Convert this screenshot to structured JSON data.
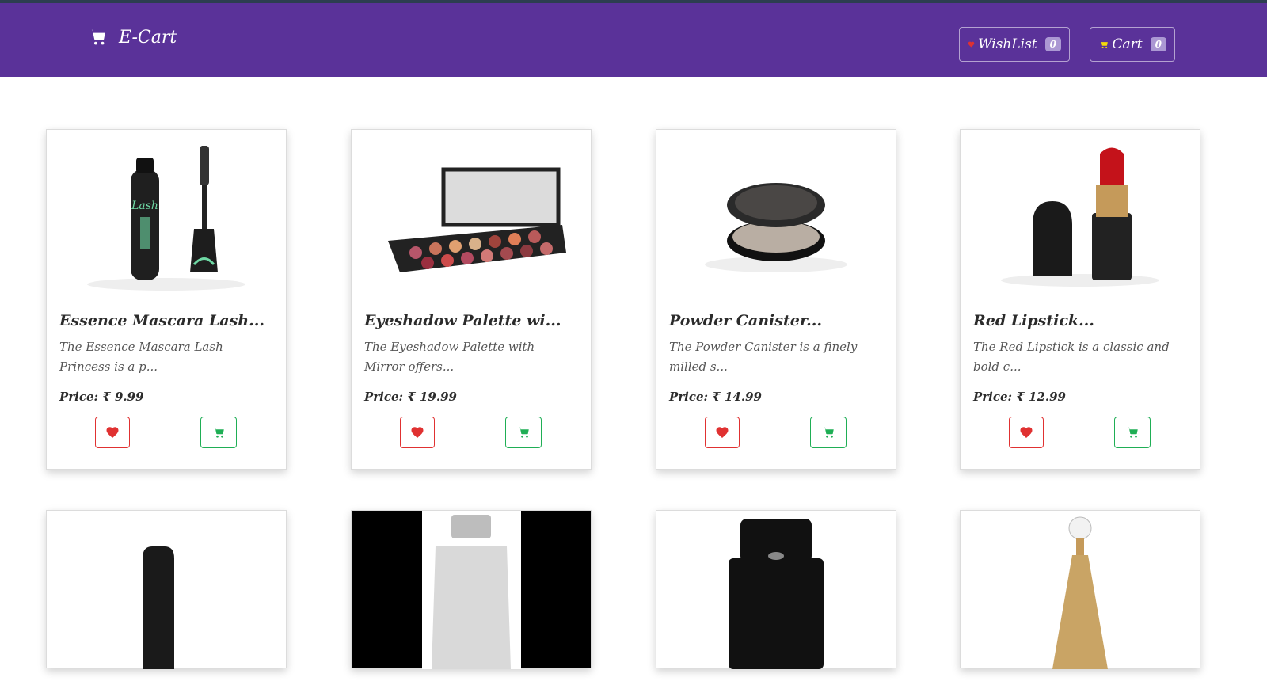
{
  "app": {
    "brand": "E-Cart",
    "wishlist_label": "WishList",
    "wishlist_count": "0",
    "cart_label": "Cart",
    "cart_count": "0"
  },
  "colors": {
    "navbar": "#5a3299",
    "wish": "#e03131",
    "cart": "#1fae55",
    "cart_nav_icon": "#f5d90a"
  },
  "products": [
    {
      "title": "Essence Mascara Lash...",
      "desc": "The Essence Mascara Lash Princess is a p...",
      "price": "Price: ₹ 9.99",
      "icon": "mascara-image"
    },
    {
      "title": "Eyeshadow Palette wi...",
      "desc": "The Eyeshadow Palette with Mirror offers...",
      "price": "Price: ₹ 19.99",
      "icon": "eyeshadow-palette-image"
    },
    {
      "title": "Powder Canister...",
      "desc": "The Powder Canister is a finely milled s...",
      "price": "Price: ₹ 14.99",
      "icon": "powder-canister-image"
    },
    {
      "title": "Red Lipstick...",
      "desc": "The Red Lipstick is a classic and bold c...",
      "price": "Price: ₹ 12.99",
      "icon": "red-lipstick-image"
    }
  ],
  "row2_images": [
    "nail-polish-image",
    "perfume-bottle-image",
    "chanel-perfume-image",
    "dior-perfume-image"
  ]
}
